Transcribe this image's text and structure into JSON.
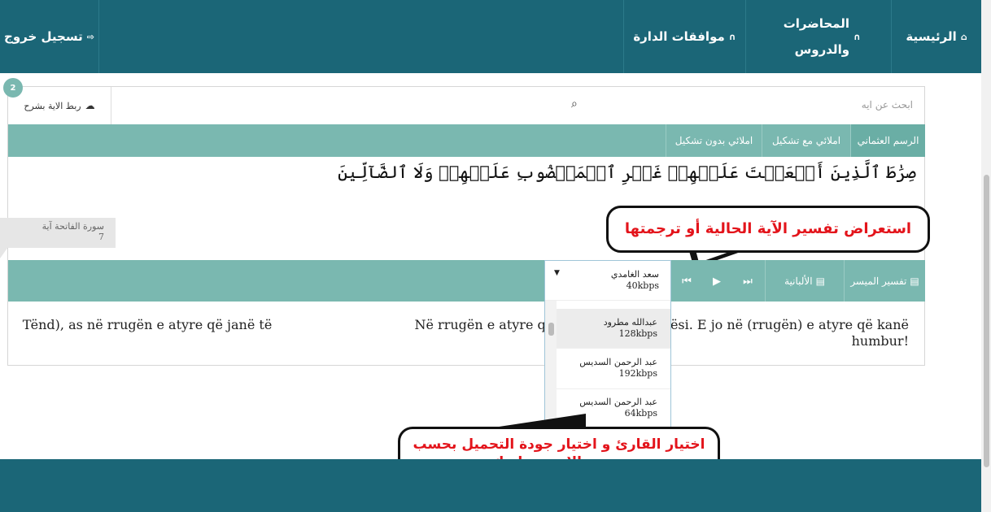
{
  "nav": {
    "home": {
      "label": "الرئيسية",
      "icon": "home-icon"
    },
    "lectures": {
      "label": "المحاضرات والدروس",
      "icon": "headphones-icon"
    },
    "approvals": {
      "label": "موافقات الدارة",
      "icon": "headphones-icon"
    },
    "logout": {
      "label": "تسجيل خروج",
      "icon": "sign-out-icon"
    }
  },
  "search": {
    "placeholder": "ابحث عن ايه",
    "badge_count": "2",
    "link_button_label": "ربط الاية بشرح",
    "link_icon": "cloud-upload-icon",
    "search_icon": "search-icon"
  },
  "script_tabs": [
    {
      "label": "الرسم العثماني",
      "active": true
    },
    {
      "label": "املائي مع تشكيل",
      "active": false
    },
    {
      "label": "املائي بدون تشكيل",
      "active": false
    }
  ],
  "ayah": {
    "text": "صِرَٰطَ ٱلَّذِينَ أَنۡعَمۡتَ عَلَيۡهِمۡ غَيۡرِ ٱلۡمَغۡضُوبِ عَلَيۡهِمۡ وَلَا ٱلضَّآلِّينَ",
    "surah_label": "سورة الفاتحة آية",
    "number": "7"
  },
  "callouts": {
    "tafsir": "استعراض تفسير الآية الحالية أو ترجمتها",
    "reciter": "اختيار القارئ و اختيار جودة التحميل بحسب سرعة الانترنت لديك"
  },
  "player": {
    "tabs": [
      {
        "label": "تفسير الميسر",
        "icon": "book-icon"
      },
      {
        "label": "الألبانية",
        "icon": "book-icon"
      }
    ],
    "buttons": {
      "next": "⏭",
      "play": "▶",
      "prev": "⏮"
    }
  },
  "reciter_select": {
    "selected": {
      "name": "سعد الغامدي",
      "bitrate": "40kbps"
    },
    "options": [
      {
        "name": "عبدالله مطرود",
        "bitrate": "128kbps",
        "highlighted": true
      },
      {
        "name": "عبد الرحمن السديس",
        "bitrate": "192kbps",
        "highlighted": false
      },
      {
        "name": "عبد الرحمن السديس",
        "bitrate": "64kbps",
        "highlighted": false
      }
    ]
  },
  "translation": {
    "text_before": "Në rrugën e atyre që u ke dhuruar mirësi. E jo në (rrugën) e atyre që kanë",
    "text_after": "Tënd), as në rrugën e atyre që janë të",
    "text_end": "!humbur"
  },
  "colors": {
    "topbar": "#1b6677",
    "teal_bar": "#7ab8b0",
    "callout_text": "#e3141b"
  }
}
